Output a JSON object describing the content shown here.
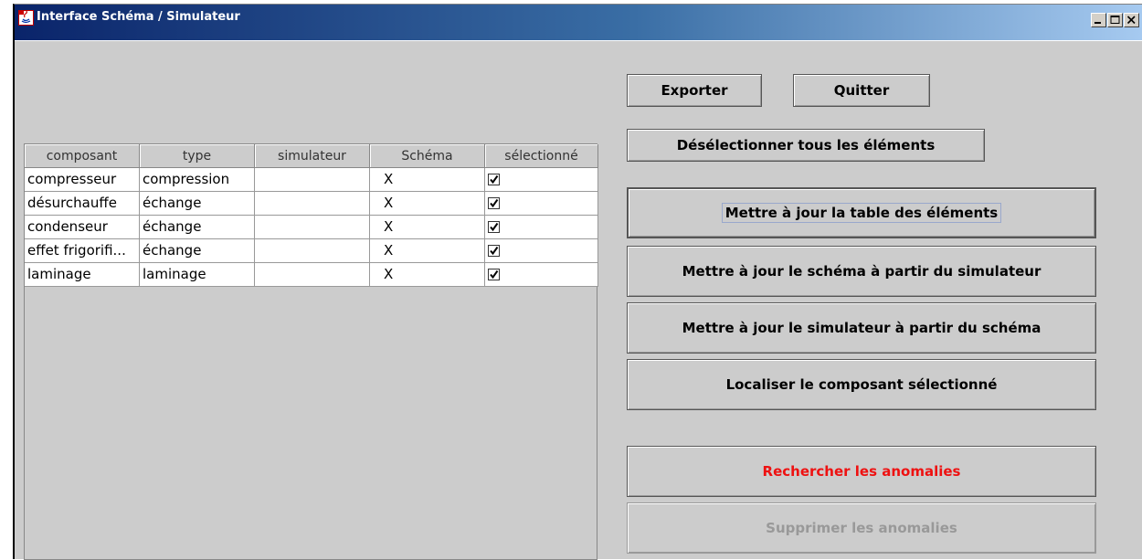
{
  "window": {
    "title": "Interface Schéma / Simulateur",
    "controls": [
      "minimize-icon",
      "maximize-icon",
      "close-icon"
    ]
  },
  "toolbar": {
    "export_label": "Exporter",
    "quit_label": "Quitter",
    "deselect_all_label": "Désélectionner tous les éléments"
  },
  "actions": {
    "update_table_label": "Mettre à jour la table des éléments",
    "update_schema_label": "Mettre à jour le schéma à partir du simulateur",
    "update_simulator_label": "Mettre à jour le simulateur à partir du schéma",
    "locate_label": "Localiser le composant sélectionné",
    "search_anomalies_label": "Rechercher les anomalies",
    "delete_anomalies_label": "Supprimer les anomalies"
  },
  "table": {
    "columns": [
      "composant",
      "type",
      "simulateur",
      "Schéma",
      "sélectionné"
    ],
    "rows": [
      {
        "composant": "compresseur",
        "type": "compression",
        "simulateur": "",
        "schema": "X",
        "selected": true
      },
      {
        "composant": "désurchauffe",
        "type": "échange",
        "simulateur": "",
        "schema": "X",
        "selected": true
      },
      {
        "composant": "condenseur",
        "type": "échange",
        "simulateur": "",
        "schema": "X",
        "selected": true
      },
      {
        "composant": "effet frigorifi...",
        "type": "échange",
        "simulateur": "",
        "schema": "X",
        "selected": true
      },
      {
        "composant": "laminage",
        "type": "laminage",
        "simulateur": "",
        "schema": "X",
        "selected": true
      }
    ]
  },
  "colors": {
    "titlebar_start": "#0a246a",
    "titlebar_end": "#a6caf0",
    "panel": "#cccccc",
    "anomaly_red": "#ee1111",
    "disabled_text": "#999999"
  }
}
